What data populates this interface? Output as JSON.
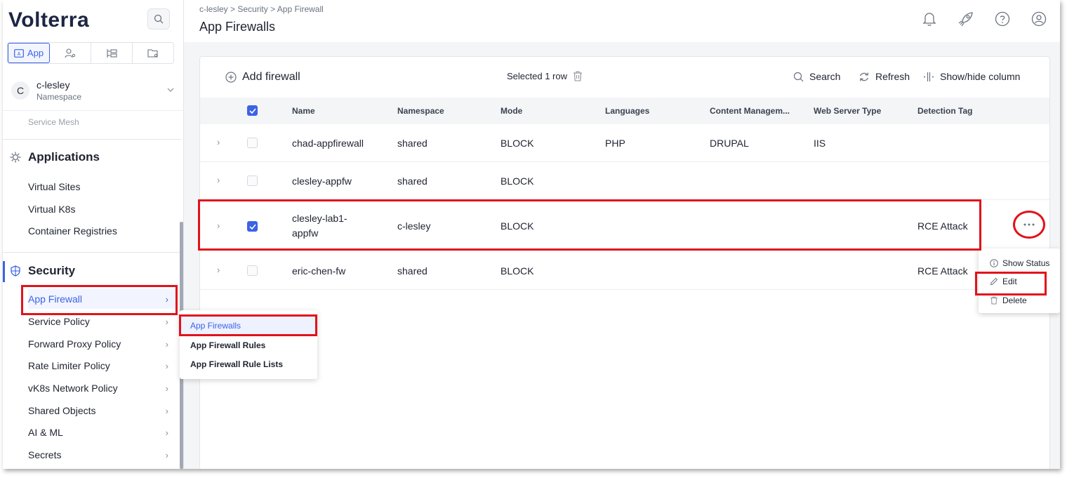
{
  "app": {
    "logo": "Volterra"
  },
  "sidebar": {
    "modes": [
      {
        "label": "App"
      }
    ],
    "namespace": {
      "initial": "C",
      "name": "c-lesley",
      "sublabel": "Namespace"
    },
    "faded_item": "Service Mesh",
    "applications": {
      "title": "Applications",
      "items": [
        {
          "label": "Virtual Sites"
        },
        {
          "label": "Virtual K8s"
        },
        {
          "label": "Container Registries"
        }
      ]
    },
    "security": {
      "title": "Security",
      "items": [
        {
          "label": "App Firewall"
        },
        {
          "label": "Service Policy"
        },
        {
          "label": "Forward Proxy Policy"
        },
        {
          "label": "Rate Limiter Policy"
        },
        {
          "label": "vK8s Network Policy"
        },
        {
          "label": "Shared Objects"
        },
        {
          "label": "AI & ML"
        },
        {
          "label": "Secrets"
        }
      ]
    }
  },
  "submenu": {
    "items": [
      {
        "label": "App Firewalls"
      },
      {
        "label": "App Firewall Rules"
      },
      {
        "label": "App Firewall Rule Lists"
      }
    ]
  },
  "header": {
    "breadcrumb": [
      "c-lesley",
      "Security",
      "App Firewall"
    ],
    "title": "App Firewalls"
  },
  "toolbar": {
    "add": "Add firewall",
    "selected": "Selected 1 row",
    "search": "Search",
    "refresh": "Refresh",
    "show_hide": "Show/hide column"
  },
  "table": {
    "columns": [
      "Name",
      "Namespace",
      "Mode",
      "Languages",
      "Content Managem...",
      "Web Server Type",
      "Detection Tag"
    ],
    "rows": [
      {
        "name": "chad-appfirewall",
        "namespace": "shared",
        "mode": "BLOCK",
        "languages": "PHP",
        "cms": "DRUPAL",
        "server": "IIS",
        "tag": ""
      },
      {
        "name": "clesley-appfw",
        "namespace": "shared",
        "mode": "BLOCK",
        "languages": "",
        "cms": "",
        "server": "",
        "tag": ""
      },
      {
        "name_line1": "clesley-lab1-",
        "name_line2": "appfw",
        "namespace": "c-lesley",
        "mode": "BLOCK",
        "languages": "",
        "cms": "",
        "server": "",
        "tag": "RCE Attack"
      },
      {
        "name": "eric-chen-fw",
        "namespace": "shared",
        "mode": "BLOCK",
        "languages": "",
        "cms": "",
        "server": "",
        "tag": "RCE Attack"
      }
    ]
  },
  "context_menu": {
    "items": [
      {
        "label": "Show Status"
      },
      {
        "label": "Edit"
      },
      {
        "label": "Delete"
      }
    ]
  },
  "colors": {
    "accent": "#3c62e6",
    "highlight": "#e1121b"
  }
}
